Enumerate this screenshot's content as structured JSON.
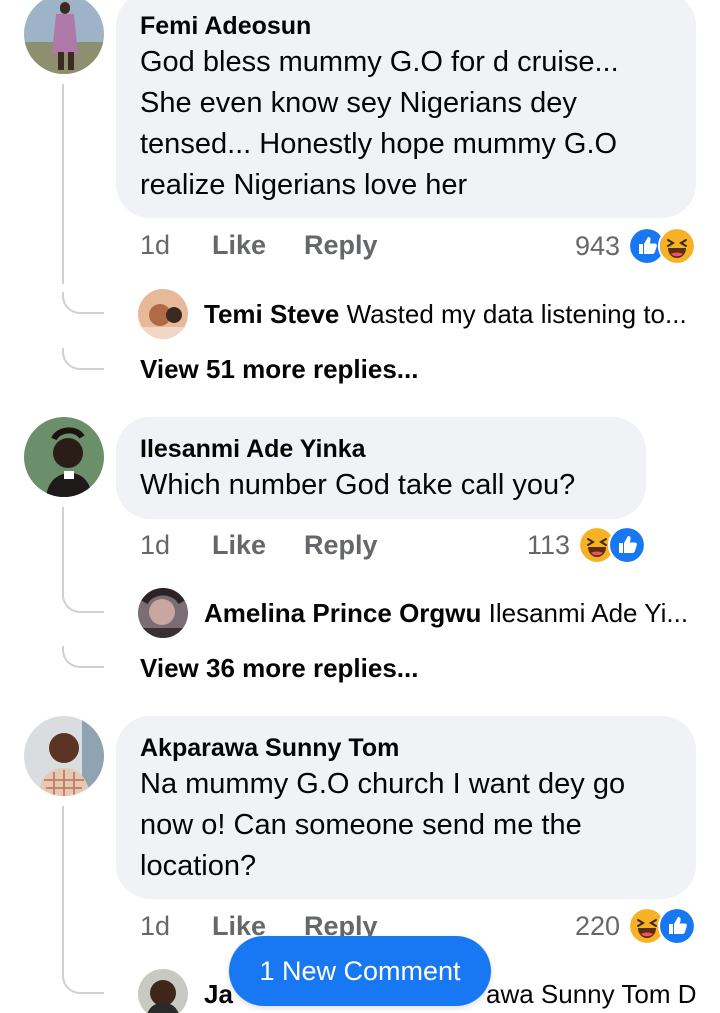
{
  "comments": [
    {
      "author": "Femi Adeosun",
      "text": "God bless mummy G.O for d cruise...\nShe even know sey Nigerians dey\ntensed... Honestly hope mummy G.O\nrealize Nigerians love her",
      "time": "1d",
      "like_label": "Like",
      "reply_label": "Reply",
      "reaction_count": "943",
      "reaction_icons": [
        "like-icon",
        "haha-icon"
      ],
      "reply_preview": {
        "author": "Temi Steve",
        "text": "Wasted my data listening to..."
      },
      "view_more": "View 51 more replies..."
    },
    {
      "author": "Ilesanmi Ade Yinka",
      "text": "Which number God take call you?",
      "time": "1d",
      "like_label": "Like",
      "reply_label": "Reply",
      "reaction_count": "113",
      "reaction_icons": [
        "haha-icon",
        "like-icon"
      ],
      "reply_preview": {
        "author": "Amelina Prince Orgwu",
        "text": "Ilesanmi Ade Yi..."
      },
      "view_more": "View 36 more replies..."
    },
    {
      "author": "Akparawa Sunny Tom",
      "text": "Na mummy G.O church I want dey go\nnow o! Can someone send me the\nlocation?",
      "time": "1d",
      "like_label": "Like",
      "reply_label": "Reply",
      "reaction_count": "220",
      "reaction_icons": [
        "haha-icon",
        "like-icon"
      ],
      "reply_preview": {
        "author": "Ja",
        "text": "awa Sunny Tom D..."
      }
    }
  ],
  "new_comment_button": "1 New Comment",
  "colors": {
    "bubble": "#f0f2f5",
    "meta_text": "#65676b",
    "thread_line": "#ced0d4",
    "accent": "#1877f2"
  }
}
